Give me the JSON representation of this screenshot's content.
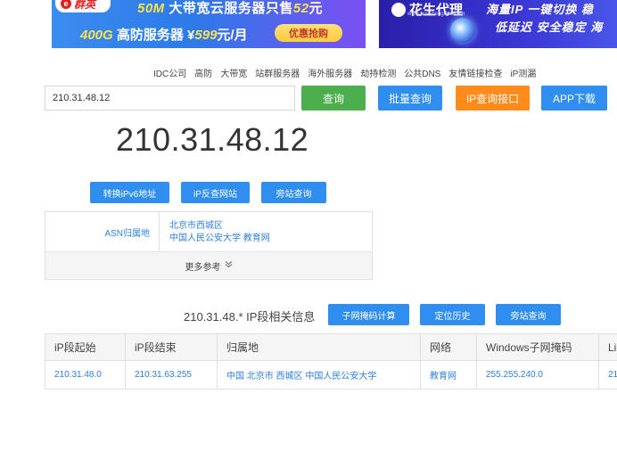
{
  "banner_left": {
    "logo_text": "群英",
    "line1_prefix": "50M",
    "line1_mid": " 大带宽云服务器只售",
    "line1_price": "52",
    "line1_suffix": "元",
    "line2_prefix": "400G",
    "line2_mid": " 高防服务器 ¥",
    "line2_price": "599",
    "line2_suffix": "元/月",
    "cta": "优惠抢购"
  },
  "banner_right": {
    "logo_text": "花生代理",
    "url": "www.huashengdaili.com",
    "line1": "海量IP  一键切换  稳",
    "line2": "低延迟  安全稳定  海"
  },
  "nav_links": [
    "IDC公司",
    "高防",
    "大带宽",
    "站群服务器",
    "海外服务器",
    "劫持检测",
    "公共DNS",
    "友情链接检查",
    "iP测漏"
  ],
  "search": {
    "value": "210.31.48.12",
    "query_label": "查询",
    "batch_label": "批量查询",
    "api_label": "IP查询接口",
    "app_label": "APP下载"
  },
  "result": {
    "ip": "210.31.48.12",
    "ipv6_label": "转换iPv6地址",
    "reverse_label": "iP反查网站",
    "side_label": "旁站查询",
    "asn_key": "ASN归属地",
    "asn_line1": "北京市西城区",
    "asn_line2": "中国人民公安大学 教育网",
    "more_label": "更多参考"
  },
  "segment": {
    "title": "210.31.48.* IP段相关信息",
    "subnet_label": "子网掩码计算",
    "loc_label": "定位历史",
    "side_label": "旁站查询",
    "headers": [
      "iP段起始",
      "iP段结束",
      "归属地",
      "网络",
      "Windows子网掩码",
      "Linux"
    ],
    "rows": [
      [
        "210.31.48.0",
        "210.31.63.255",
        "中国 北京市 西城区 中国人民公安大学",
        "教育网",
        "255.255.240.0",
        "21"
      ]
    ]
  },
  "colors": {
    "green": "#4cae4c",
    "blue": "#2f8ef0",
    "orange": "#ff8c1a",
    "link": "#2f7fe0"
  }
}
